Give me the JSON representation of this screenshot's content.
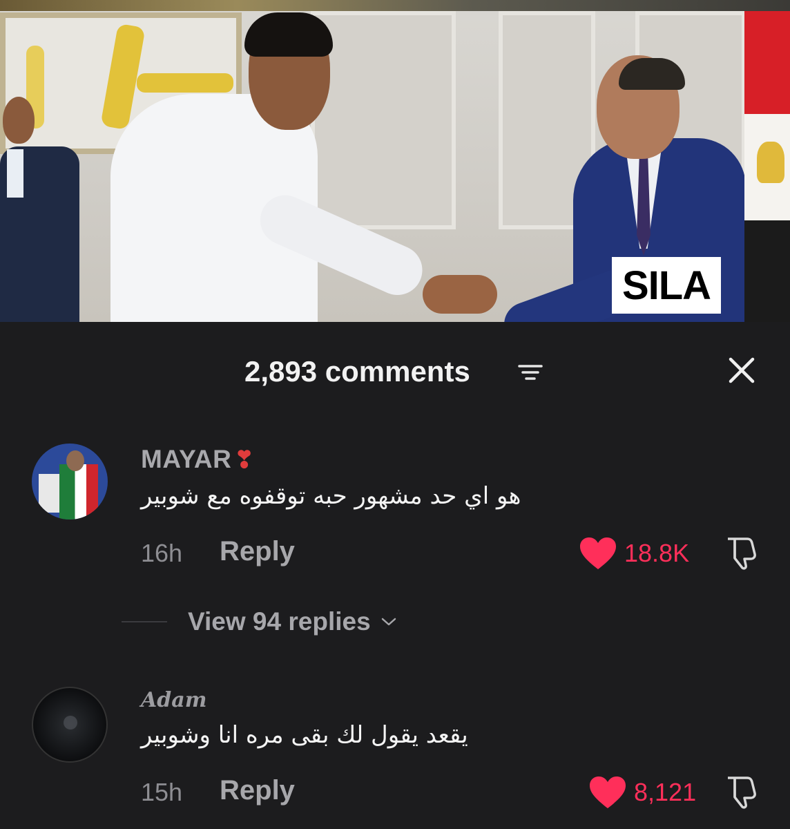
{
  "overlay_label": "SILA",
  "sheet": {
    "comment_count": "2,893 comments",
    "sort_icon": "sort-lines-icon",
    "close_icon": "close-icon"
  },
  "comments": [
    {
      "username": "MAYAR",
      "username_emoji": "❣",
      "text": "هو اي حد مشهور حبه توقفوه مع شوبير",
      "time": "16h",
      "reply_label": "Reply",
      "likes": "18.8K",
      "view_replies": "View 94 replies"
    },
    {
      "username": "Adam",
      "text": "يقعد يقول لك بقى مره انا وشوبير",
      "time": "15h",
      "reply_label": "Reply",
      "likes": "8,121"
    }
  ],
  "colors": {
    "sheet_bg": "#1c1c1e",
    "like_red": "#ff2f5a",
    "muted_text": "#a7a7ab"
  }
}
